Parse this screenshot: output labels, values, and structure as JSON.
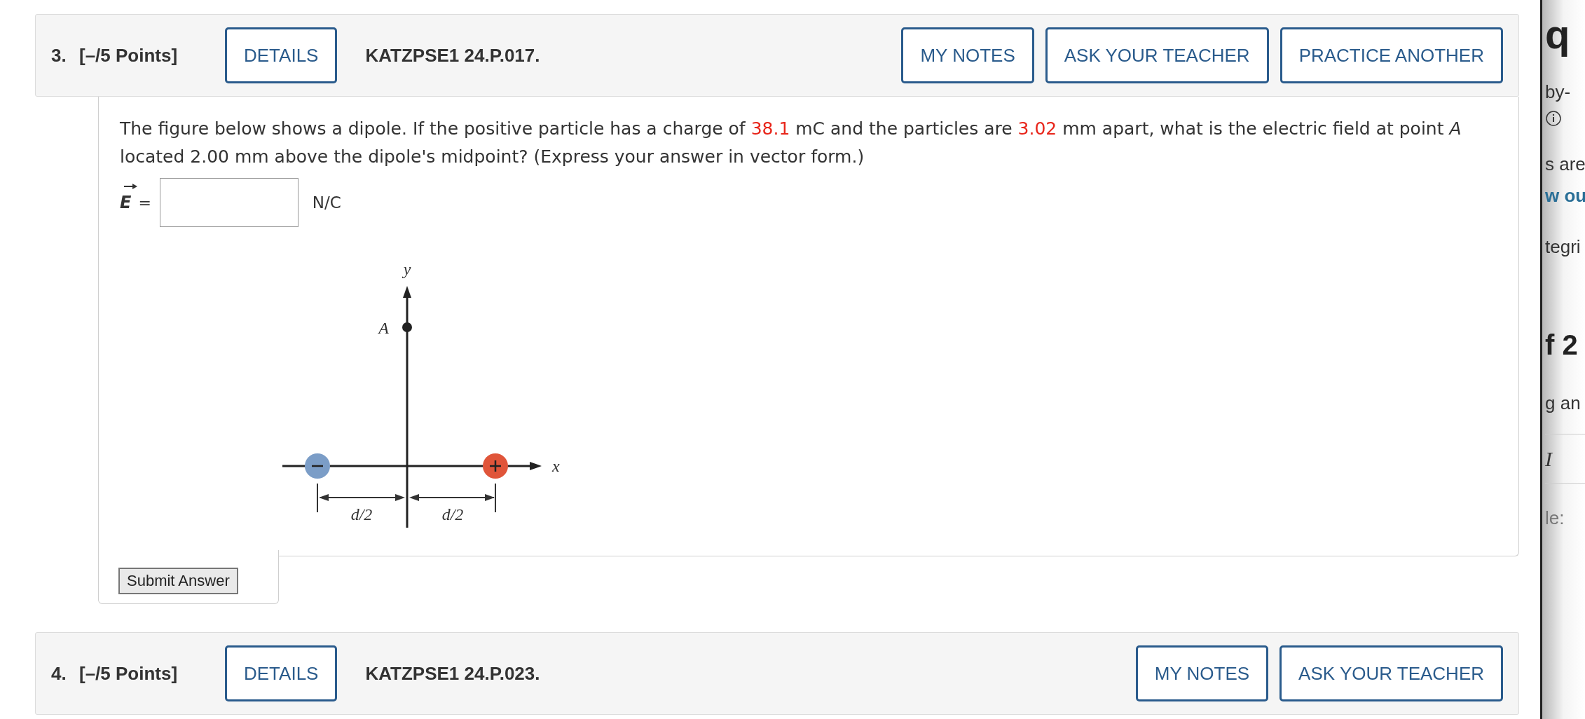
{
  "question_3": {
    "number": "3.",
    "points": "[–/5 Points]",
    "details": "DETAILS",
    "code": "KATZPSE1 24.P.017.",
    "actions": [
      "MY NOTES",
      "ASK YOUR TEACHER",
      "PRACTICE ANOTHER"
    ],
    "prompt": [
      {
        "kind": "plain",
        "text": "The figure below shows a dipole. If the positive particle has a charge of "
      },
      {
        "kind": "value",
        "text": "38.1"
      },
      {
        "kind": "plain",
        "text": " mC and the particles are "
      },
      {
        "kind": "value",
        "text": "3.02"
      },
      {
        "kind": "plain",
        "text": " mm apart, what is the electric field at point "
      },
      {
        "kind": "variable",
        "text": "A"
      },
      {
        "kind": "plain",
        "text": " located 2.00 mm above the dipole's midpoint? (Express your answer in vector form.)"
      }
    ],
    "answer": {
      "symbol": "E",
      "relation": "=",
      "unit": "N/C"
    },
    "figure": {
      "y_label": "y",
      "x_label": "x",
      "point_label": "A",
      "spacing_labels": [
        "d/2",
        "d/2"
      ]
    },
    "submit": "Submit Answer"
  },
  "question_4": {
    "number": "4.",
    "points": "[–/5 Points]",
    "details": "DETAILS",
    "code": "KATZPSE1 24.P.023.",
    "actions": [
      "MY NOTES",
      "ASK YOUR TEACHER"
    ]
  },
  "side_panel": [
    {
      "kind": "heading",
      "text": "q"
    },
    {
      "kind": "text",
      "text": "by-"
    },
    {
      "kind": "info"
    },
    {
      "kind": "text",
      "text": "s are"
    },
    {
      "kind": "link",
      "text": "w ou"
    },
    {
      "kind": "text",
      "text": "tegri"
    },
    {
      "kind": "heading2",
      "text": "f 2"
    },
    {
      "kind": "text",
      "text": "g an"
    },
    {
      "kind": "toolbar",
      "text": "I"
    },
    {
      "kind": "muted",
      "text": "le:"
    }
  ]
}
